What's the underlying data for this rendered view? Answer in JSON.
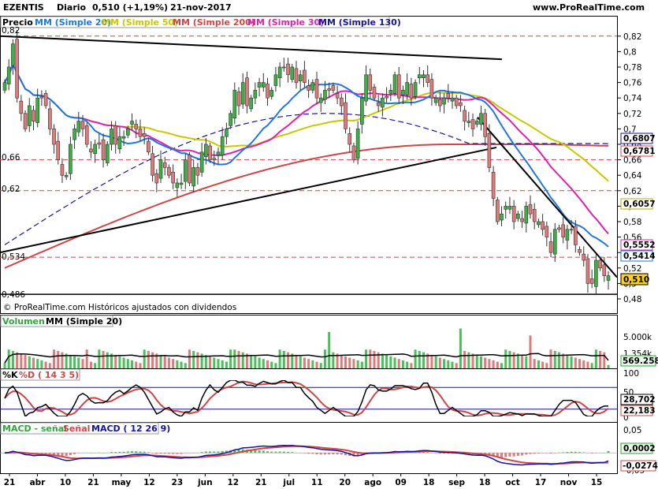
{
  "header": {
    "symbol": "EZENTIS",
    "period": "Diario",
    "quote": "0,510 (+1,19%)",
    "date": "21-nov-2017",
    "site": "www.ProRealTime.com"
  },
  "price_panel": {
    "legend": [
      "Precio",
      "MM (Simple 20)",
      "MM (Simple 50)",
      "MM (Simple 200)",
      "MM (Simple 30)",
      "MM (Simple 130)"
    ],
    "legend_colors": [
      "#000000",
      "#1f78e0",
      "#c8c800",
      "#d04545",
      "#e020b0",
      "#1414a0"
    ],
    "left_labels": [
      "0,82",
      "0,66",
      "0,62",
      "0,534",
      "0,486"
    ],
    "y_ticks": [
      "0,82",
      "0,8",
      "0,78",
      "0,76",
      "0,74",
      "0,72",
      "0,7",
      "0,68",
      "0,66",
      "0,64",
      "0,62",
      "0,6",
      "0,58",
      "0,56",
      "0,54",
      "0,52",
      "0,5",
      "0,48"
    ],
    "badges": [
      {
        "text": "0,6807",
        "color": "#1414a0"
      },
      {
        "text": "0,6781",
        "color": "#d04545"
      },
      {
        "text": "0,6057",
        "color": "#b0b000"
      },
      {
        "text": "0,5552",
        "color": "#e020b0"
      },
      {
        "text": "0,5414",
        "color": "#1f78e0"
      },
      {
        "text": "0,510",
        "color": "#000000"
      }
    ],
    "footer": "© ProRealTime.com  Históricos ajustados con dividendos"
  },
  "volume_panel": {
    "legend": [
      "Volumen",
      "MM (Simple 20)"
    ],
    "y_ticks": [
      "5.000k",
      "1.354k"
    ],
    "badge": "569.258"
  },
  "stoch_panel": {
    "legend": [
      "%K",
      "%D ( 14 3 5)"
    ],
    "y_ticks": [
      "100",
      "50",
      "0"
    ],
    "badges": [
      "28,702",
      "22,183"
    ]
  },
  "macd_panel": {
    "legend": [
      "MACD - señal",
      "Señal",
      "MACD ( 12 26 9)"
    ],
    "y_ticks": [
      "0,05",
      "0",
      "-0,05"
    ],
    "badges": [
      "0,0002",
      "-0,0274"
    ]
  },
  "x_axis": {
    "labels": [
      "21",
      "abr",
      "10",
      "21",
      "may",
      "12",
      "23",
      "jun",
      "12",
      "21",
      "jul",
      "11",
      "20",
      "ago",
      "09",
      "18",
      "sep",
      "18",
      "oct",
      "17",
      "nov",
      "15"
    ]
  },
  "chart_data": {
    "type": "candlestick",
    "instrument": "EZENTIS",
    "period": "Diario",
    "last": 0.51,
    "change_pct": 1.19,
    "date": "21-nov-2017",
    "price_ylim": [
      0.48,
      0.83
    ],
    "price_series": {
      "close": [
        0.76,
        0.78,
        0.81,
        0.74,
        0.72,
        0.7,
        0.73,
        0.71,
        0.74,
        0.74,
        0.73,
        0.7,
        0.68,
        0.66,
        0.64,
        0.64,
        0.68,
        0.7,
        0.71,
        0.7,
        0.68,
        0.67,
        0.68,
        0.68,
        0.66,
        0.68,
        0.7,
        0.68,
        0.69,
        0.69,
        0.7,
        0.71,
        0.7,
        0.69,
        0.69,
        0.67,
        0.64,
        0.63,
        0.66,
        0.65,
        0.64,
        0.63,
        0.63,
        0.63,
        0.66,
        0.63,
        0.65,
        0.64,
        0.67,
        0.68,
        0.66,
        0.66,
        0.67,
        0.69,
        0.7,
        0.72,
        0.75,
        0.73,
        0.76,
        0.73,
        0.74,
        0.75,
        0.76,
        0.76,
        0.74,
        0.75,
        0.77,
        0.78,
        0.78,
        0.77,
        0.78,
        0.76,
        0.77,
        0.76,
        0.75,
        0.76,
        0.74,
        0.74,
        0.75,
        0.75,
        0.75,
        0.74,
        0.73,
        0.7,
        0.68,
        0.66,
        0.7,
        0.74,
        0.77,
        0.75,
        0.74,
        0.73,
        0.74,
        0.74,
        0.75,
        0.77,
        0.74,
        0.75,
        0.76,
        0.74,
        0.76,
        0.77,
        0.77,
        0.76,
        0.74,
        0.74,
        0.73,
        0.74,
        0.74,
        0.74,
        0.73,
        0.73,
        0.71,
        0.71,
        0.7,
        0.71,
        0.72,
        0.69,
        0.65,
        0.61,
        0.58,
        0.59,
        0.6,
        0.6,
        0.58,
        0.59,
        0.58,
        0.6,
        0.59,
        0.58,
        0.58,
        0.57,
        0.56,
        0.54,
        0.57,
        0.57,
        0.56,
        0.57,
        0.57,
        0.55,
        0.54,
        0.53,
        0.5,
        0.5,
        0.53,
        0.52,
        0.51,
        0.51
      ]
    },
    "sma20_end": 0.5414,
    "sma30_end": 0.5552,
    "sma50_end": 0.6057,
    "sma130_end": 0.6807,
    "sma200_end": 0.6781,
    "horizontal_levels": [
      0.82,
      0.66,
      0.62,
      0.534,
      0.486
    ],
    "volume_sma20_end": 1354000,
    "volume_last": 569258,
    "volume_ylim": [
      0,
      7000000
    ],
    "stochastic": {
      "k_end": 28.702,
      "d_end": 22.183,
      "ylim": [
        0,
        100
      ],
      "levels": [
        80,
        20
      ]
    },
    "macd": {
      "signal_end": 0.0002,
      "macd_end": -0.0274,
      "ylim": [
        -0.07,
        0.06
      ]
    }
  }
}
